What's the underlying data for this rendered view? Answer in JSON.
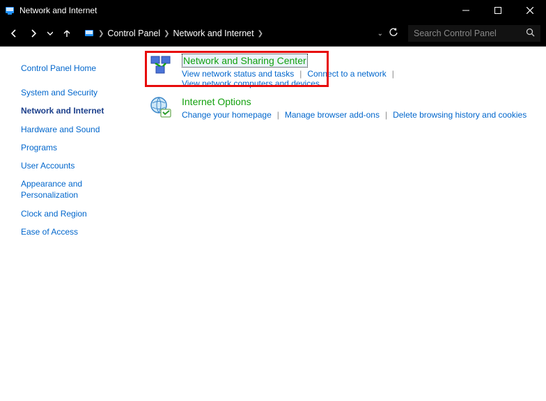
{
  "window": {
    "title": "Network and Internet"
  },
  "breadcrumb": {
    "seg1": "Control Panel",
    "seg2": "Network and Internet"
  },
  "search": {
    "placeholder": "Search Control Panel"
  },
  "sidebar": {
    "home": "Control Panel Home",
    "items": [
      "System and Security",
      "Network and Internet",
      "Hardware and Sound",
      "Programs",
      "User Accounts",
      "Appearance and Personalization",
      "Clock and Region",
      "Ease of Access"
    ]
  },
  "cat1": {
    "title": "Network and Sharing Center",
    "link1": "View network status and tasks",
    "link2": "Connect to a network",
    "link3": "View network computers and devices"
  },
  "cat2": {
    "title": "Internet Options",
    "link1": "Change your homepage",
    "link2": "Manage browser add-ons",
    "link3": "Delete browsing history and cookies"
  }
}
